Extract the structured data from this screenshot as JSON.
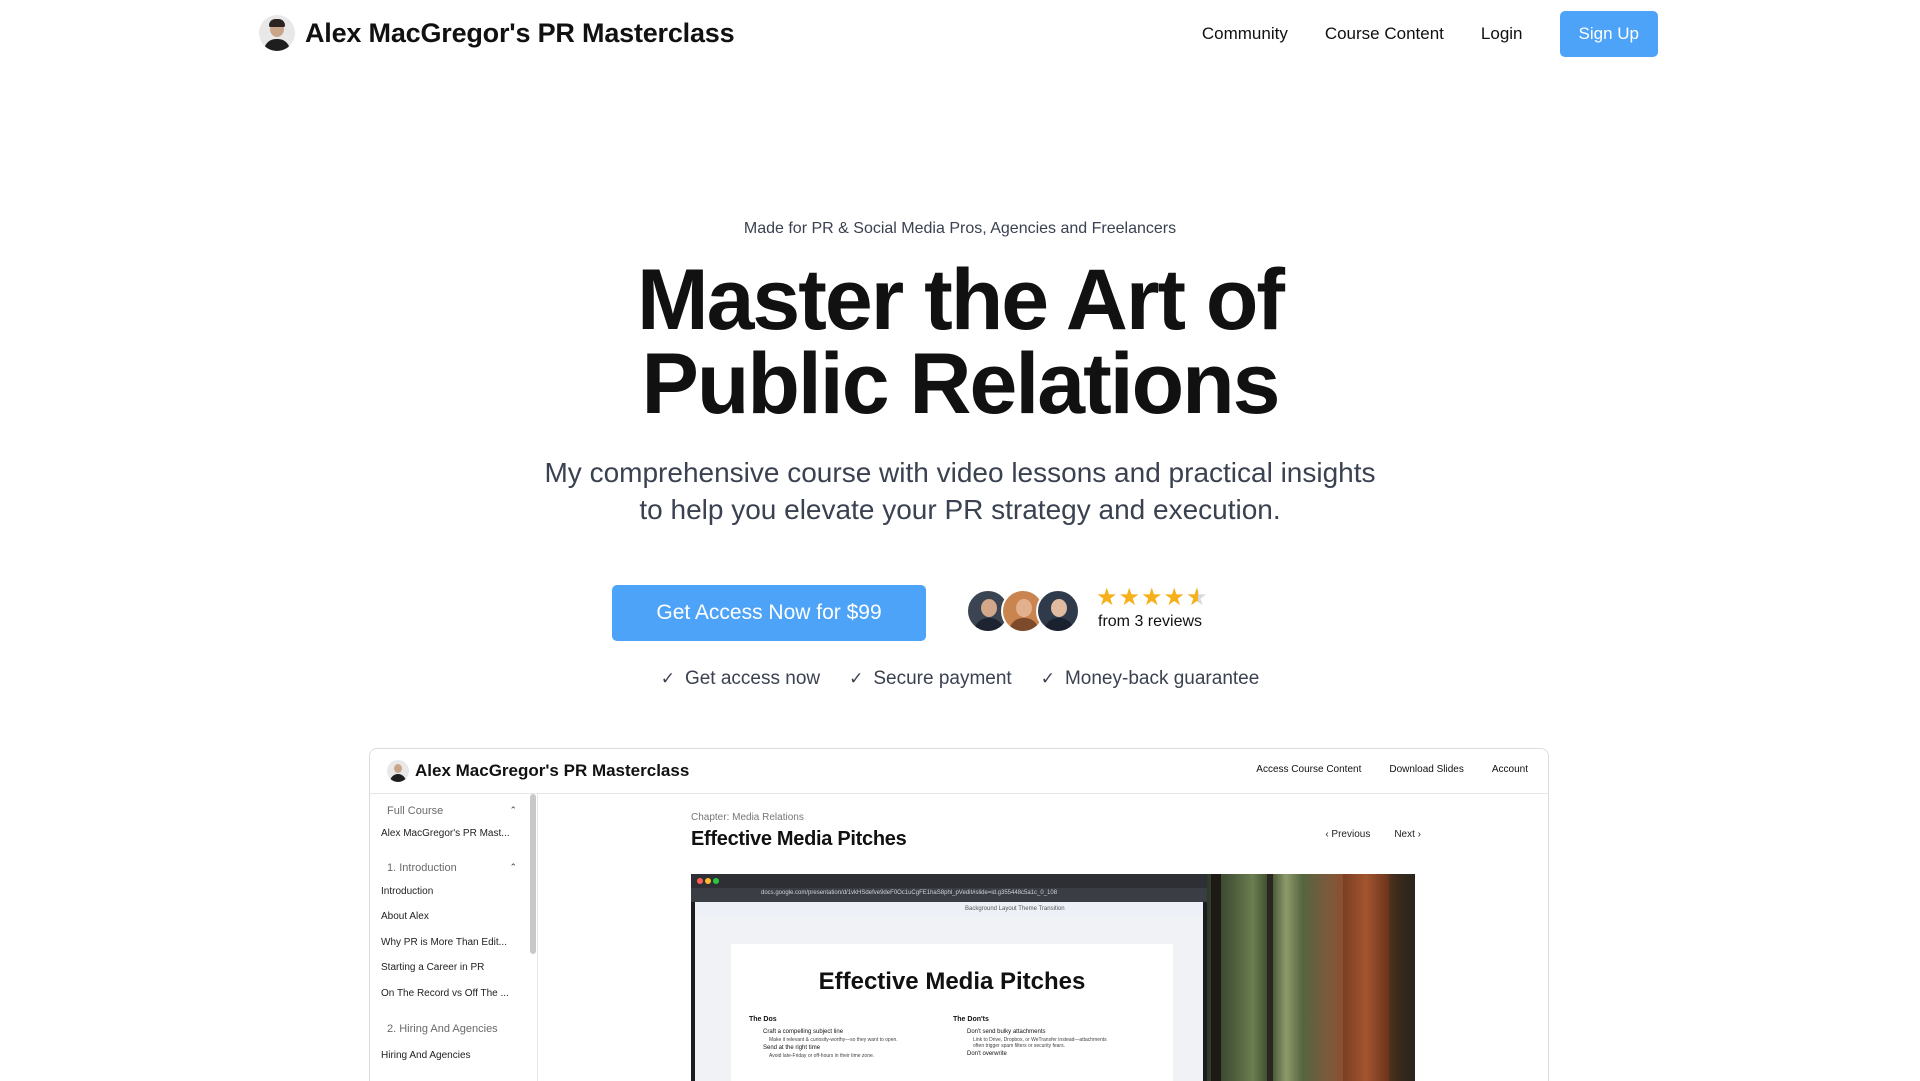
{
  "header": {
    "brand_title": "Alex MacGregor's PR Masterclass",
    "nav": [
      "Community",
      "Course Content",
      "Login"
    ],
    "signup_label": "Sign Up"
  },
  "hero": {
    "eyebrow": "Made for PR & Social Media Pros, Agencies and Freelancers",
    "title_line1": "Master the Art of",
    "title_line2": "Public Relations",
    "subtitle_line1": "My comprehensive course with video lessons and practical insights",
    "subtitle_line2": "to help you elevate your PR strategy and execution.",
    "cta_label": "Get Access Now for $99",
    "rating": 4.5,
    "reviews_text": "from 3 reviews",
    "features": [
      "Get access now",
      "Secure payment",
      "Money-back guarantee"
    ]
  },
  "preview": {
    "brand_title": "Alex MacGregor's PR Masterclass",
    "nav": [
      "Access Course Content",
      "Download Slides",
      "Account"
    ],
    "sidebar": {
      "sections": [
        {
          "title": "Full Course",
          "items": [
            "Alex MacGregor's PR Mast..."
          ]
        },
        {
          "title": "1. Introduction",
          "items": [
            "Introduction",
            "About Alex",
            "Why PR is More Than Edit...",
            "Starting a Career in PR",
            "On The Record vs Off The ..."
          ]
        },
        {
          "title": "2. Hiring And Agencies",
          "items": [
            "Hiring And Agencies"
          ]
        }
      ]
    },
    "chapter": "Chapter: Media Relations",
    "lesson_title": "Effective Media Pitches",
    "prev_label": "Previous",
    "next_label": "Next",
    "video": {
      "url": "docs.google.com/presentation/d/1vkHSdefve9deF0Oc1uCgFE1haS8phl_pVedit#slide=id.g355448c5a1c_0_108",
      "toolbar_items": "Background   Layout   Theme   Transition",
      "slide_title": "Effective Media Pitches",
      "dos_heading": "The Dos",
      "dos": [
        {
          "title": "Craft a compelling subject line",
          "sub": "Make it relevant & curiosity-worthy—so they want to open."
        },
        {
          "title": "Send at the right time",
          "sub": "Avoid late-Friday or off-hours in their time zone."
        }
      ],
      "donts_heading": "The Don'ts",
      "donts": [
        {
          "title": "Don't send bulky attachments",
          "sub": "Link to Drive, Dropbox, or WeTransfer instead—attachments often trigger spam filters or security fears."
        },
        {
          "title": "Don't overwrite",
          "sub": ""
        }
      ]
    }
  },
  "colors": {
    "accent": "#4da3f7",
    "star": "#f5b01a",
    "text_muted": "#3a4150"
  }
}
